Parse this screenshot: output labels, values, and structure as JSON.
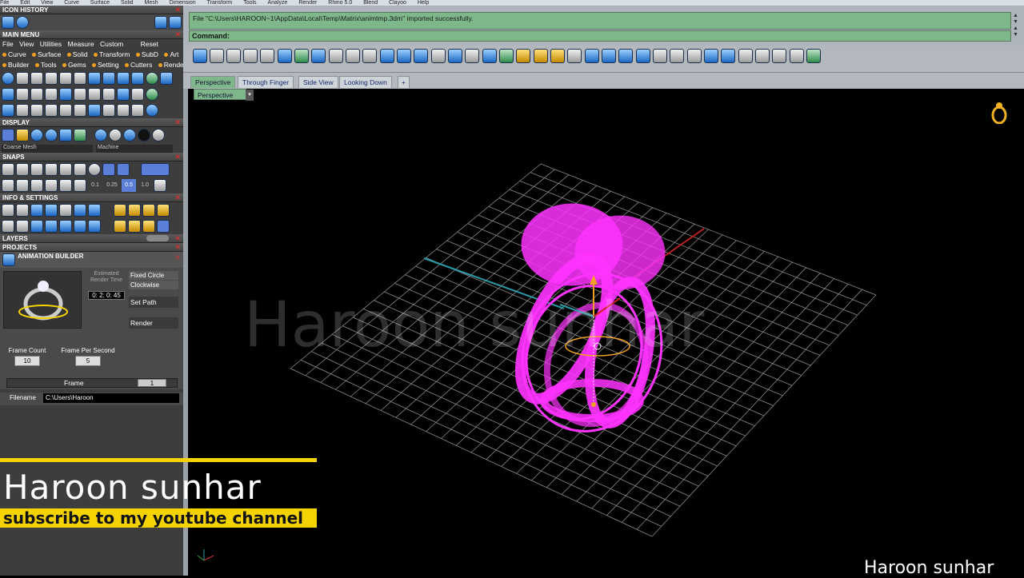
{
  "menubar": [
    "File",
    "Edit",
    "View",
    "Curve",
    "Surface",
    "Solid",
    "Mesh",
    "Dimension",
    "Transform",
    "Tools",
    "Analyze",
    "Render",
    "Rhino 5.0",
    "Blend",
    "Clayoo",
    "Help"
  ],
  "left": {
    "icon_history": "ICON HISTORY",
    "main_menu": "MAIN MENU",
    "main_menu_row1": [
      "File",
      "View",
      "Utilities",
      "Measure",
      "Custom"
    ],
    "reset": "Reset",
    "main_menu_row2": [
      "Curve",
      "Surface",
      "Solid",
      "Transform",
      "SubD",
      "Art"
    ],
    "main_menu_row3": [
      "Builder",
      "Tools",
      "Gems",
      "Setting",
      "Cutters",
      "Render"
    ],
    "display": "DISPLAY",
    "display_mesh": "Coarse Mesh",
    "display_mat": "Machine",
    "snaps": "SNAPS",
    "snap_values": [
      "0.1",
      "0.25",
      "0.5",
      "1.0"
    ],
    "info_settings": "INFO & SETTINGS",
    "layers": "LAYERS",
    "projects": "PROJECTS",
    "animation_builder": "ANIMATION BUILDER",
    "estimated_label": "Estimated Render Time",
    "estimated_value": "0: 2: 0: 45",
    "path_type": "Fixed Circle",
    "direction": "Clockwise",
    "set_path": "Set Path",
    "render": "Render",
    "frame_count_label": "Frame Count",
    "frame_count": "10",
    "fps_label": "Frame Per Second",
    "fps": "5",
    "frame_label": "Frame",
    "frame_value": "1",
    "filename_label": "Filename",
    "filename_value": "C:\\Users\\Haroon"
  },
  "history": "File \"C:\\Users\\HAROON~1\\AppData\\Local\\Temp\\Matrix\\animtmp.3dm\" imported successfully.",
  "command_label": "Command:",
  "tabs": [
    "Perspective",
    "Through Finger",
    "Side View",
    "Looking Down",
    "+"
  ],
  "viewport_label": "Perspective",
  "overlay": {
    "name": "Haroon sunhar",
    "subscribe": "subscribe to my youtube channel",
    "watermark_bottom": "Haroon sunhar",
    "watermark_center": "Haroon sunhar"
  },
  "colors": {
    "ring": "#ff33ff",
    "grid": "#8a8a8a",
    "accent_yellow": "#f4d300",
    "command_bg": "#7eb88a"
  }
}
